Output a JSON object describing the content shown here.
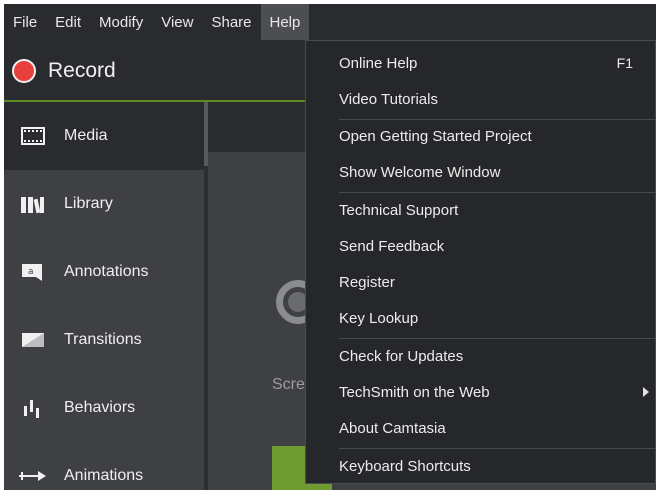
{
  "menubar": {
    "items": [
      "File",
      "Edit",
      "Modify",
      "View",
      "Share",
      "Help"
    ]
  },
  "record": {
    "label": "Record"
  },
  "sidebar": {
    "items": [
      {
        "label": "Media",
        "icon": "film-icon"
      },
      {
        "label": "Library",
        "icon": "library-icon"
      },
      {
        "label": "Annotations",
        "icon": "annotation-icon"
      },
      {
        "label": "Transitions",
        "icon": "transition-icon"
      },
      {
        "label": "Behaviors",
        "icon": "behaviors-icon"
      },
      {
        "label": "Animations",
        "icon": "animation-arrow-icon"
      }
    ]
  },
  "canvas": {
    "partial_text": "Scre"
  },
  "help_menu": {
    "groups": [
      [
        {
          "label": "Online Help",
          "shortcut": "F1"
        },
        {
          "label": "Video Tutorials"
        }
      ],
      [
        {
          "label": "Open Getting Started Project"
        },
        {
          "label": "Show Welcome Window"
        }
      ],
      [
        {
          "label": "Technical Support"
        },
        {
          "label": "Send Feedback"
        },
        {
          "label": "Register"
        },
        {
          "label": "Key Lookup"
        }
      ],
      [
        {
          "label": "Check for Updates"
        },
        {
          "label": "TechSmith on the Web",
          "submenu": true
        },
        {
          "label": "About Camtasia"
        }
      ],
      [
        {
          "label": "Keyboard Shortcuts"
        }
      ]
    ]
  },
  "colors": {
    "record_red": "#e8403a",
    "accent_green": "#6e9a31",
    "menu_bg": "#26272a",
    "app_bg": "#3f4043"
  }
}
